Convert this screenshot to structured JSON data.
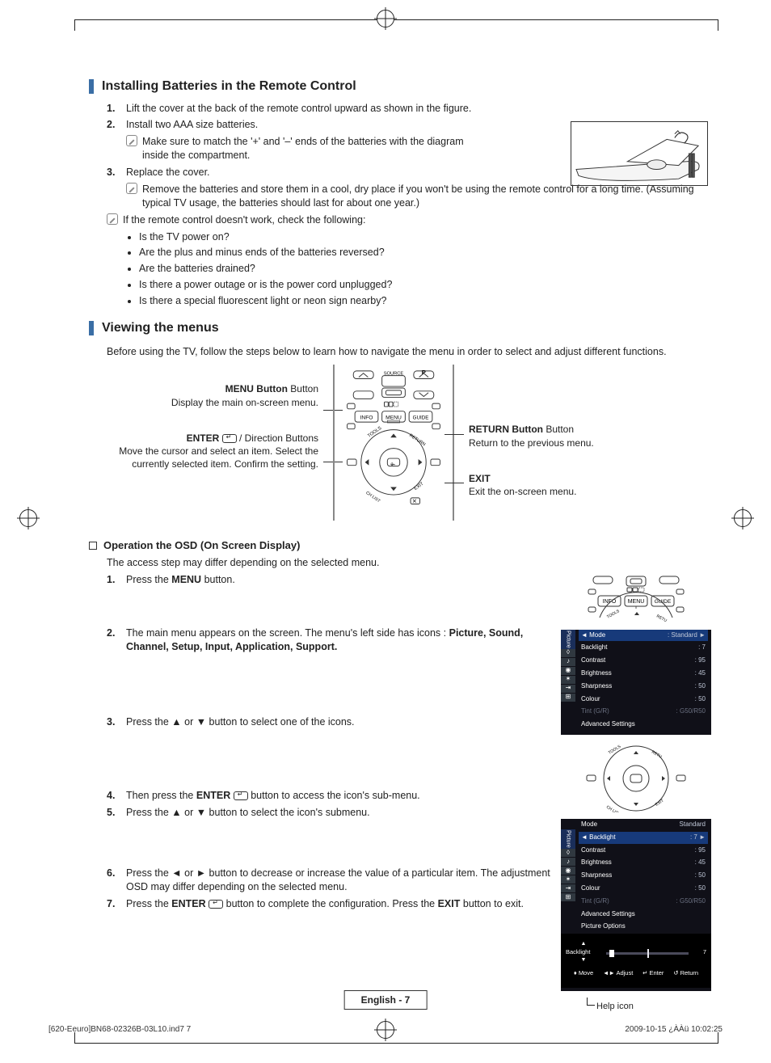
{
  "section1": {
    "title": "Installing Batteries in the Remote Control",
    "steps": {
      "s1": {
        "num": "1.",
        "text": "Lift the cover at the back of the remote control upward as shown in the figure."
      },
      "s2": {
        "num": "2.",
        "text": "Install two AAA size batteries.",
        "note": "Make sure to match the '+' and '–' ends of the batteries with the diagram inside the compartment."
      },
      "s3": {
        "num": "3.",
        "text": "Replace the cover.",
        "note": "Remove the batteries and store them in a cool, dry place if you won't be using the remote control for a long time. (Assuming typical TV usage, the batteries should last for about one year.)"
      }
    },
    "check_intro": "If the remote control doesn't work, check the following:",
    "checks": [
      "Is the TV power on?",
      "Are the plus and minus ends of the batteries reversed?",
      "Are the batteries drained?",
      "Is there a power outage or is the power cord unplugged?",
      "Is there a special fluorescent light or neon sign nearby?"
    ]
  },
  "section2": {
    "title": "Viewing the menus",
    "intro": "Before using the TV, follow the steps below to learn how to navigate the menu in order to select and adjust different functions.",
    "labels": {
      "menu_btn_title": "MENU Button",
      "menu_btn_desc": "Display the main on-screen menu.",
      "enter_btn_title": "ENTER",
      "enter_btn_suffix": " / Direction Buttons",
      "enter_btn_desc": "Move the cursor and select an item. Select the currently selected item. Confirm the setting.",
      "return_btn_title": "RETURN Button",
      "return_btn_desc": "Return to the previous menu.",
      "exit_title": "EXIT",
      "exit_desc": "Exit the on-screen menu."
    },
    "remote_labels": {
      "source": "SOURCE",
      "info": "INFO",
      "menu": "MENU",
      "guide": "GUIDE",
      "tools": "TOOLS",
      "return": "RETURN",
      "chlist": "CH LIST",
      "exit": "EXIT",
      "p": "P"
    }
  },
  "osd": {
    "title": "Operation the OSD (On Screen Display)",
    "desc": "The access step may differ depending on the selected menu.",
    "steps": {
      "s1": {
        "num": "1.",
        "text_a": "Press the ",
        "menu": "MENU",
        "text_b": " button."
      },
      "s2": {
        "num": "2.",
        "text_a": "The main menu appears on the screen. The menu's left side has icons : ",
        "bold": "Picture, Sound, Channel, Setup, Input, Application, Support."
      },
      "s3": {
        "num": "3.",
        "text": "Press the ▲ or ▼ button to select one of the icons."
      },
      "s4": {
        "num": "4.",
        "text_a": "Then press the ",
        "enter": "ENTER",
        "text_b": " button to access the icon's sub-menu."
      },
      "s5": {
        "num": "5.",
        "text": "Press the ▲ or ▼ button to select the icon's submenu."
      },
      "s6": {
        "num": "6.",
        "text": "Press the ◄ or ► button to decrease or increase the value of a particular item. The adjustment OSD may differ depending on the selected menu."
      },
      "s7": {
        "num": "7.",
        "text_a": "Press the ",
        "enter": "ENTER",
        "text_b": " button to complete the configuration. Press the ",
        "exit": "EXIT",
        "text_c": " button to exit."
      }
    }
  },
  "menu": {
    "tab": "Picture",
    "rows": {
      "mode": {
        "label": "Mode",
        "value": ": Standard"
      },
      "backlight": {
        "label": "Backlight",
        "value": ": 7"
      },
      "contrast": {
        "label": "Contrast",
        "value": ": 95"
      },
      "brightness": {
        "label": "Brightness",
        "value": ": 45"
      },
      "sharpness": {
        "label": "Sharpness",
        "value": ": 50"
      },
      "colour": {
        "label": "Colour",
        "value": ": 50"
      },
      "tint": {
        "label": "Tint (G/R)",
        "value": ": G50/R50"
      },
      "adv": {
        "label": "Advanced Settings"
      },
      "picopt": {
        "label": "Picture Options"
      }
    },
    "slider": {
      "label": "Backlight",
      "value": "7"
    },
    "help": {
      "move": "Move",
      "adjust": "Adjust",
      "enter": "Enter",
      "return": "Return"
    },
    "help_icon_label": "Help icon",
    "screen2": {
      "mode_label": "Mode",
      "mode_value": "Standard"
    }
  },
  "footer": {
    "page": "English - 7",
    "file": "[620-Eeuro]BN68-02326B-03L10.ind7   7",
    "date": "2009-10-15   ¿ÀÀü 10:02:25"
  }
}
